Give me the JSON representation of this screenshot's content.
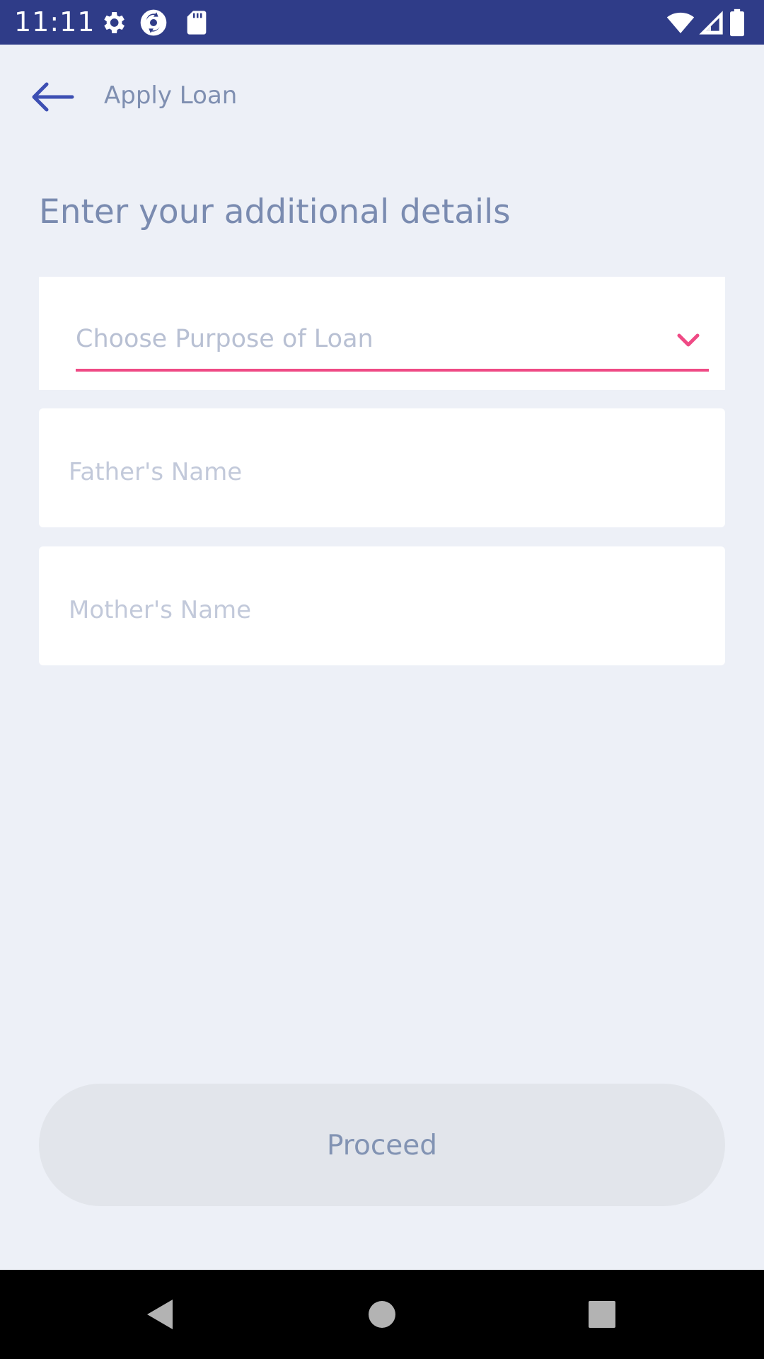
{
  "status_bar": {
    "time": "11:11",
    "left_icons": [
      "gear-icon",
      "sync-app-icon",
      "sd-card-icon"
    ],
    "right_icons": [
      "wifi-icon",
      "cell-signal-icon",
      "battery-icon"
    ],
    "background": "#2f3c88"
  },
  "app_bar": {
    "title": "Apply Loan",
    "back_icon": "arrow-left-icon"
  },
  "form": {
    "heading": "Enter your additional details",
    "purpose": {
      "placeholder": "Choose Purpose of Loan",
      "accent_color": "#ef4a85"
    },
    "father_name": {
      "placeholder": "Father's Name",
      "value": ""
    },
    "mother_name": {
      "placeholder": "Mother's Name",
      "value": ""
    }
  },
  "actions": {
    "proceed_label": "Proceed"
  },
  "nav_bar": {
    "buttons": [
      "back-triangle-icon",
      "home-circle-icon",
      "recents-square-icon"
    ]
  },
  "colors": {
    "page_background": "#edf0f7",
    "text_muted": "#7a8bb0",
    "accent": "#ef4a85",
    "primary": "#3d4fb3"
  }
}
